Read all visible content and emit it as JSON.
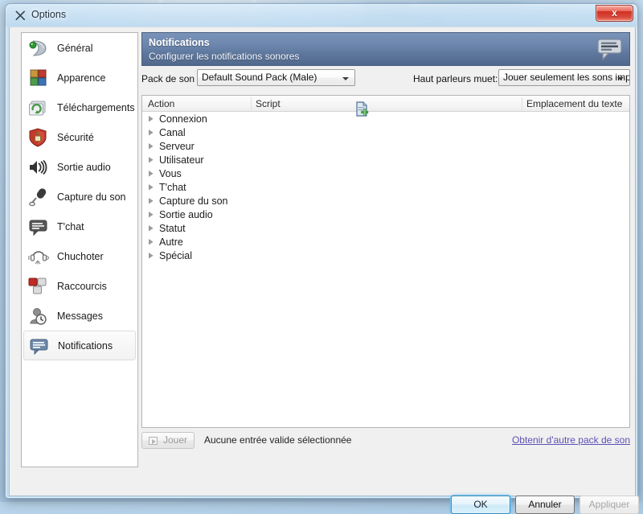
{
  "window": {
    "title": "Options",
    "title_icon": "scissors-tool-icon",
    "close_label": "x"
  },
  "sidebar": {
    "items": [
      {
        "label": "Général",
        "icon": "general-sound-wave-icon",
        "selected": false
      },
      {
        "label": "Apparence",
        "icon": "appearance-squares-icon",
        "selected": false
      },
      {
        "label": "Téléchargements",
        "icon": "downloads-refresh-icon",
        "selected": false
      },
      {
        "label": "Sécurité",
        "icon": "security-shield-lock-icon",
        "selected": false
      },
      {
        "label": "Sortie audio",
        "icon": "speaker-output-icon",
        "selected": false
      },
      {
        "label": "Capture du son",
        "icon": "microphone-icon",
        "selected": false
      },
      {
        "label": "T'chat",
        "icon": "chat-bubble-icon",
        "selected": false
      },
      {
        "label": "Chuchoter",
        "icon": "headset-whisper-icon",
        "selected": false
      },
      {
        "label": "Raccourcis",
        "icon": "hotkeys-blocks-icon",
        "selected": false
      },
      {
        "label": "Messages",
        "icon": "messages-clock-icon",
        "selected": false
      },
      {
        "label": "Notifications",
        "icon": "notifications-bubble-icon",
        "selected": true
      }
    ]
  },
  "banner": {
    "title": "Notifications",
    "subtitle": "Configurer les notifications sonores",
    "icon": "notifications-bubble-icon"
  },
  "toolbar": {
    "sound_pack_label": "Pack de son :",
    "sound_pack_value": "Default Sound Pack (Male)",
    "import_pack_icon": "import-sound-pack-icon",
    "mute_label": "Haut parleurs muet:",
    "mute_value": "Jouer seulement les sons importants"
  },
  "list": {
    "columns": [
      "Action",
      "Script",
      "Emplacement du texte"
    ],
    "rows": [
      {
        "label": "Connexion",
        "script": "",
        "text_location": ""
      },
      {
        "label": "Canal",
        "script": "",
        "text_location": ""
      },
      {
        "label": "Serveur",
        "script": "",
        "text_location": ""
      },
      {
        "label": "Utilisateur",
        "script": "",
        "text_location": ""
      },
      {
        "label": "Vous",
        "script": "",
        "text_location": ""
      },
      {
        "label": "T'chat",
        "script": "",
        "text_location": ""
      },
      {
        "label": "Capture du son",
        "script": "",
        "text_location": ""
      },
      {
        "label": "Sortie audio",
        "script": "",
        "text_location": ""
      },
      {
        "label": "Statut",
        "script": "",
        "text_location": ""
      },
      {
        "label": "Autre",
        "script": "",
        "text_location": ""
      },
      {
        "label": "Spécial",
        "script": "",
        "text_location": ""
      }
    ]
  },
  "footer": {
    "play_label": "Jouer",
    "play_icon": "play-icon",
    "status": "Aucune entrée valide sélectionnée",
    "get_packs_link": "Obtenir d'autre pack de son"
  },
  "dialog_buttons": {
    "ok": "OK",
    "cancel": "Annuler",
    "apply": "Appliquer"
  },
  "colors": {
    "banner_blue": "#60799f",
    "link_purple": "#5b50b4",
    "close_red": "#cf3123",
    "default_button_glow": "#3c8dbc"
  }
}
